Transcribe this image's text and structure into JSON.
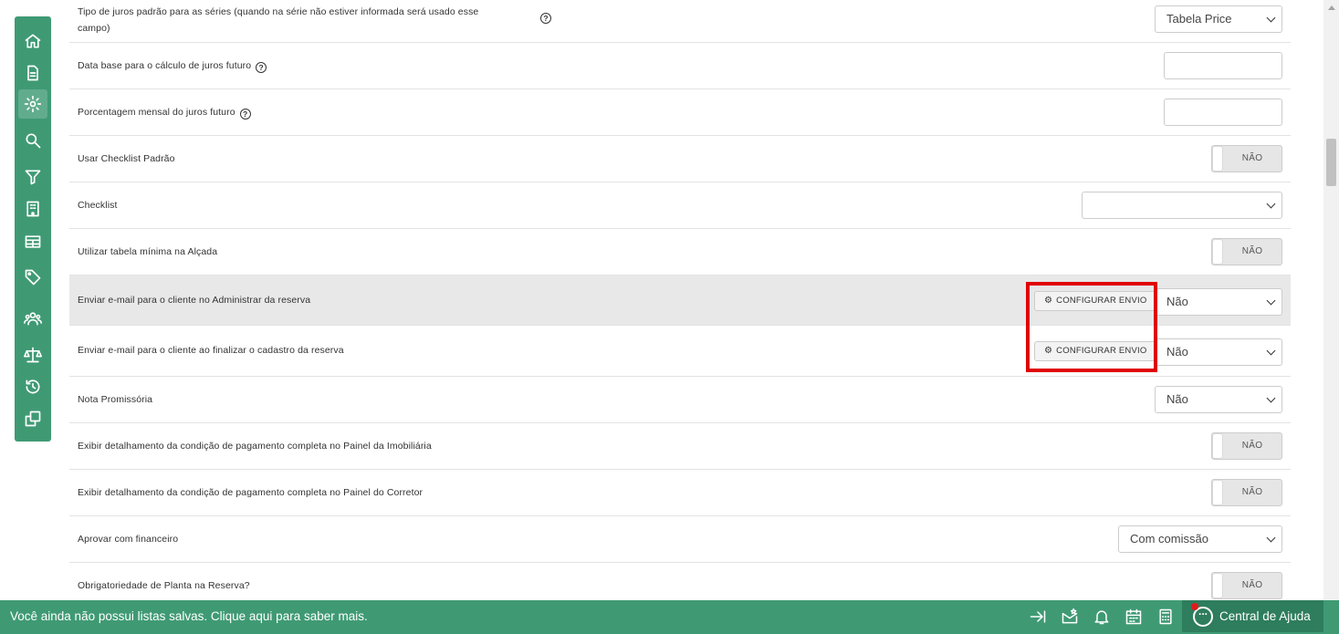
{
  "sidebar": {
    "items": [
      {
        "icon": "home-icon",
        "active": false
      },
      {
        "icon": "document-icon",
        "active": false
      },
      {
        "icon": "gear-icon",
        "active": true
      },
      {
        "icon": "search-icon",
        "active": false
      },
      {
        "icon": "filter-icon",
        "active": false
      },
      {
        "icon": "building-icon",
        "active": false
      },
      {
        "icon": "table-icon",
        "active": false
      },
      {
        "icon": "tag-icon",
        "active": false
      },
      {
        "icon": "users-icon",
        "active": false
      },
      {
        "icon": "scale-icon",
        "active": false
      },
      {
        "icon": "history-icon",
        "active": false
      },
      {
        "icon": "copy-icon",
        "active": false
      }
    ]
  },
  "settings": {
    "tipo_juros": {
      "label_line1": "Tipo de juros padrão para as séries (quando na série não estiver informada será usado esse",
      "label_line2": "campo)",
      "value": "Tabela Price"
    },
    "data_base": {
      "label": "Data base para o cálculo de juros futuro",
      "value": ""
    },
    "porcentagem": {
      "label": "Porcentagem mensal do juros futuro",
      "value": ""
    },
    "checklist_padrao": {
      "label": "Usar Checklist Padrão",
      "value": "NÃO"
    },
    "checklist": {
      "label": "Checklist",
      "value": ""
    },
    "tabela_minima": {
      "label": "Utilizar tabela mínima na Alçada",
      "value": "NÃO"
    },
    "email_administrar": {
      "label": "Enviar e-mail para o cliente no Administrar da reserva",
      "button": "CONFIGURAR ENVIO",
      "value": "Não"
    },
    "email_finalizar": {
      "label": "Enviar e-mail para o cliente ao finalizar o cadastro da reserva",
      "button": "CONFIGURAR ENVIO",
      "value": "Não"
    },
    "nota_promissoria": {
      "label": "Nota Promissória",
      "value": "Não"
    },
    "detalhamento_imobiliaria": {
      "label": "Exibir detalhamento da condição de pagamento completa no Painel da Imobiliária",
      "value": "NÃO"
    },
    "detalhamento_corretor": {
      "label": "Exibir detalhamento da condição de pagamento completa no Painel do Corretor",
      "value": "NÃO"
    },
    "aprovar_financeiro": {
      "label": "Aprovar com financeiro",
      "value": "Com comissão"
    },
    "planta_reserva": {
      "label": "Obrigatoriedade de Planta na Reserva?",
      "value": "NÃO"
    }
  },
  "bottombar": {
    "message": "Você ainda não possui listas salvas. Clique aqui para saber mais.",
    "help_center": "Central de Ajuda",
    "icons": [
      "export-icon",
      "saved-list-icon",
      "bell-icon",
      "calendar-icon",
      "calculator-icon"
    ]
  },
  "colors": {
    "brand_green": "#3f9a74",
    "highlight_red": "#e00000"
  }
}
